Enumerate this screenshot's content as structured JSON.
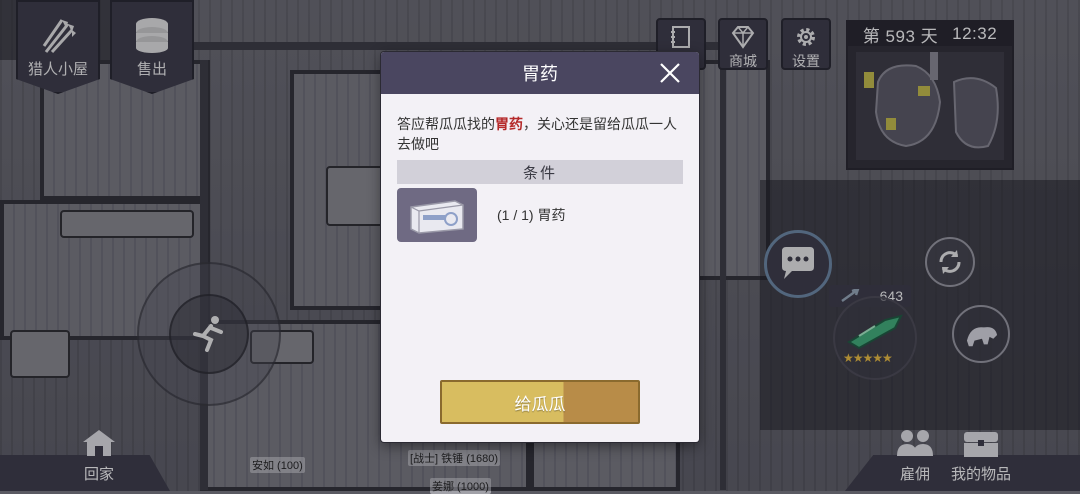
{
  "hud": {
    "hunter_cabin_label": "猎人小屋",
    "sell_label": "售出",
    "shop_label": "商城",
    "settings_label": "设置",
    "day_label": "第 593 天",
    "clock": "12:32",
    "power_value": "643",
    "home_label": "回家",
    "hire_label": "雇佣",
    "my_items_label": "我的物品"
  },
  "npcs": [
    {
      "name": "安如 (100)"
    },
    {
      "name": "[战士] 铁锤 (1680)"
    },
    {
      "name": "姜娜 (1000)"
    }
  ],
  "dialog": {
    "title": "胃药",
    "desc_prefix": "答应帮瓜瓜找的",
    "desc_highlight": "胃药",
    "desc_suffix": "，关心还是留给瓜瓜一人去做吧",
    "conditions_label": "条件",
    "requirement_text": "(1 / 1) 胃药",
    "give_button": "给瓜瓜"
  },
  "colors": {
    "dialog_header": "#4a4660",
    "highlight": "#b52a2a",
    "give_button": "#d8bd60"
  }
}
